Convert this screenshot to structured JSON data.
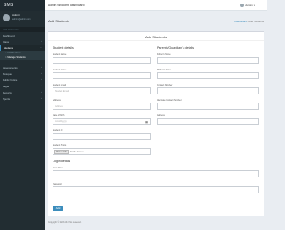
{
  "app": {
    "brand": "SMS"
  },
  "user": {
    "name": "Admin",
    "email": "admin@admin.com"
  },
  "sidebar": {
    "headers": [
      "NAVIGATION",
      "LINKS"
    ],
    "items": [
      {
        "label": "Dashboard",
        "chevron": ""
      },
      {
        "label": "Class",
        "chevron": "‹"
      },
      {
        "label": "Students",
        "chevron": "‹"
      },
      {
        "label": "Assessments",
        "chevron": "‹"
      },
      {
        "label": "Mosque",
        "chevron": "‹"
      },
      {
        "label": "Public Notice",
        "chevron": "‹"
      },
      {
        "label": "Fagar",
        "chevron": "‹"
      },
      {
        "label": "Reports",
        "chevron": "‹"
      },
      {
        "label": "Sports",
        "chevron": "‹"
      }
    ],
    "sub_items": [
      "Add Students",
      "Manage Students"
    ]
  },
  "topbar": {
    "title": "Admin Welcome dashboard",
    "user": "Admin"
  },
  "page": {
    "title": "Add Students",
    "breadcrumb": {
      "home": "Dashboard",
      "sep": "/",
      "current": "Add Students"
    }
  },
  "form": {
    "title": "Add Students",
    "student_section": "Student details",
    "parent_section": "Parents/Guardian's details",
    "login_section": "Login details",
    "student_fields": {
      "first_name": {
        "label": "Student Name",
        "placeholder": ""
      },
      "last_name": {
        "label": "Student Name",
        "placeholder": ""
      },
      "student_email": {
        "label": "Student Email",
        "placeholder": "Student Email"
      },
      "address": {
        "label": "Address",
        "placeholder": "Address"
      },
      "dob": {
        "label": "Date of Birth",
        "placeholder": "mm/dd/yyyy"
      },
      "student_id": {
        "label": "Student ID",
        "placeholder": ""
      },
      "photo": {
        "label": "Student Photo",
        "button": "Choose File",
        "text": "No file chosen"
      }
    },
    "parent_fields": {
      "father_name": {
        "label": "Father's Name",
        "placeholder": ""
      },
      "mother_name": {
        "label": "Mother's Name",
        "placeholder": ""
      },
      "contact": {
        "label": "Contact Number",
        "placeholder": ""
      },
      "alt_contact": {
        "label": "Alternate Contact Number",
        "placeholder": ""
      },
      "address": {
        "label": "Address",
        "placeholder": ""
      }
    },
    "login_fields": {
      "username": {
        "label": "User Name",
        "placeholder": ""
      },
      "password": {
        "label": "Password",
        "placeholder": ""
      }
    },
    "submit_label": "Add"
  },
  "footer": {
    "text": "Copyright © 2023 All rights reserved."
  }
}
